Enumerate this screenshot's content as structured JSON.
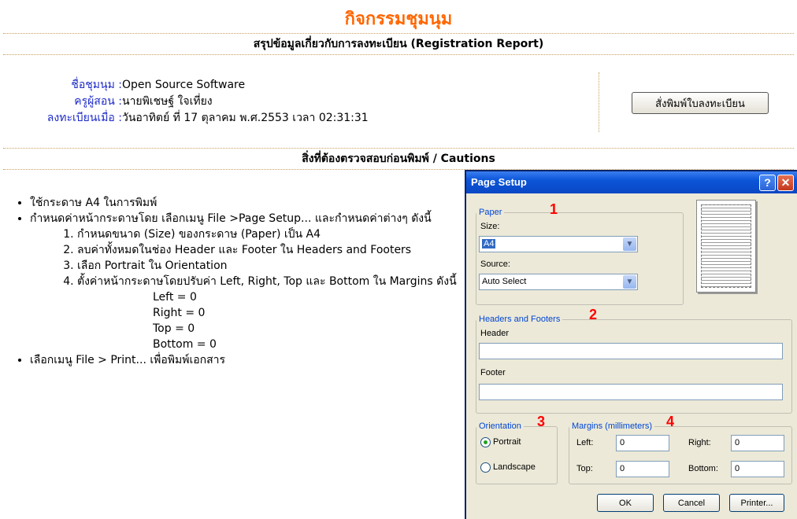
{
  "page": {
    "title": "กิจกรรมชุมนุม",
    "report_header": "สรุปข้อมูลเกี่ยวกับการลงทะเบียน (Registration Report)",
    "club_label": "ชื่อชุมนุม :",
    "club_value": "Open Source Software",
    "teacher_label": "ครูผู้สอน :",
    "teacher_value": "นายพิเชษฐ์ ใจเที่ยง",
    "registered_label": "ลงทะเบียนเมื่อ :",
    "registered_value": "วันอาทิตย์ ที่ 17 ตุลาคม พ.ศ.2553 เวลา 02:31:31",
    "print_button": "สั่งพิมพ์ใบลงทะเบียน",
    "cautions_header": "สิ่งที่ต้องตรวจสอบก่อนพิมพ์ / Cautions"
  },
  "cautions": {
    "item1": "ใช้กระดาษ A4 ในการพิมพ์",
    "item2": "กำหนดค่าหน้ากระดาษโดย เลือกเมนู File >Page Setup... และกำหนดค่าต่างๆ ดังนี้",
    "steps": [
      "กำหนดขนาด (Size) ของกระดาษ (Paper) เป็น A4",
      "ลบค่าทั้งหมดในช่อง Header และ Footer ใน Headers and Footers",
      "เลือก Portrait ใน Orientation",
      "ตั้งค่าหน้ากระดาษโดยปรับค่า Left, Right, Top และ Bottom ใน Margins ดังนี้"
    ],
    "margins": [
      "Left = 0",
      "Right = 0",
      "Top = 0",
      "Bottom = 0"
    ],
    "item3": "เลือกเมนู File > Print... เพื่อพิมพ์เอกสาร"
  },
  "dialog": {
    "title": "Page Setup",
    "help": "?",
    "close": "✕",
    "paper_legend": "Paper",
    "size_label": "Size:",
    "size_value": "A4",
    "source_label": "Source:",
    "source_value": "Auto Select",
    "hf_legend": "Headers and Footers",
    "header_label": "Header",
    "footer_label": "Footer",
    "orientation_legend": "Orientation",
    "portrait": "Portrait",
    "landscape": "Landscape",
    "portrait_selected": true,
    "margins_legend": "Margins (millimeters)",
    "left_label": "Left:",
    "left_value": "0",
    "right_label": "Right:",
    "right_value": "0",
    "top_label": "Top:",
    "top_value": "0",
    "bottom_label": "Bottom:",
    "bottom_value": "0",
    "ok": "OK",
    "cancel": "Cancel",
    "printer": "Printer...",
    "annotations": [
      "1",
      "2",
      "3",
      "4"
    ]
  }
}
